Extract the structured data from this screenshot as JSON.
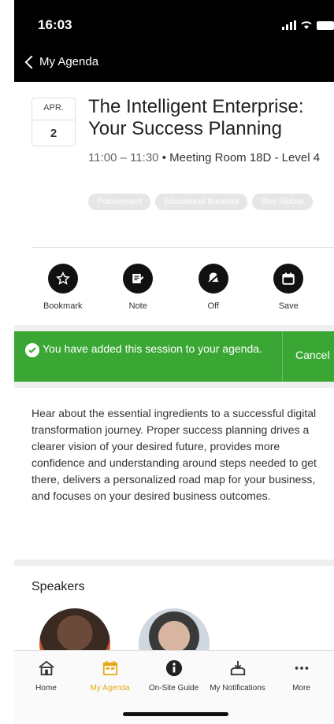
{
  "status": {
    "time": "16:03"
  },
  "nav": {
    "back_label": "My Agenda"
  },
  "session": {
    "month": "APR.",
    "day": "2",
    "title": "The Intelligent Enterprise: Your Success Planning",
    "time_range": "11:00 – 11:30",
    "location": " • Meeting Room 18D - Level 4",
    "tags": [
      "Procurement",
      "Educational Breakout",
      "Blue Ribbon"
    ]
  },
  "actions": [
    {
      "label": "Bookmark",
      "icon": "star-icon"
    },
    {
      "label": "Note",
      "icon": "note-icon"
    },
    {
      "label": "Off",
      "icon": "bell-off-icon"
    },
    {
      "label": "Save",
      "icon": "calendar-icon"
    }
  ],
  "banner": {
    "message": "You have added this session to your agenda.",
    "cancel_label": "Cancel",
    "color": "#3aa734"
  },
  "description": "Hear about the essential ingredients to a successful digital transformation journey. Proper success planning drives a clearer vision of your desired future, provides more confidence and understanding around steps needed to get there, delivers a personalized road map for your business, and focuses on your desired business outcomes.",
  "speakers": {
    "heading": "Speakers"
  },
  "tabbar": {
    "items": [
      {
        "label": "Home",
        "icon": "home-icon"
      },
      {
        "label": "My Agenda",
        "icon": "agenda-icon"
      },
      {
        "label": "On-Site Guide",
        "icon": "info-icon"
      },
      {
        "label": "My Notifications",
        "icon": "inbox-download-icon"
      },
      {
        "label": "More",
        "icon": "more-icon"
      }
    ],
    "active_color": "#e6a817"
  }
}
